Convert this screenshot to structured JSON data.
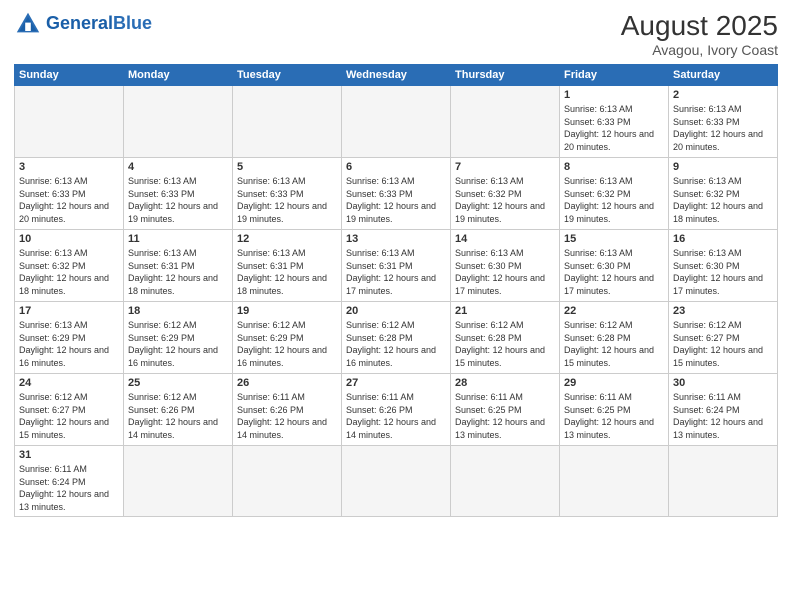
{
  "header": {
    "logo_general": "General",
    "logo_blue": "Blue",
    "month_year": "August 2025",
    "location": "Avagou, Ivory Coast"
  },
  "weekdays": [
    "Sunday",
    "Monday",
    "Tuesday",
    "Wednesday",
    "Thursday",
    "Friday",
    "Saturday"
  ],
  "weeks": [
    [
      {
        "day": "",
        "info": ""
      },
      {
        "day": "",
        "info": ""
      },
      {
        "day": "",
        "info": ""
      },
      {
        "day": "",
        "info": ""
      },
      {
        "day": "",
        "info": ""
      },
      {
        "day": "1",
        "info": "Sunrise: 6:13 AM\nSunset: 6:33 PM\nDaylight: 12 hours and 20 minutes."
      },
      {
        "day": "2",
        "info": "Sunrise: 6:13 AM\nSunset: 6:33 PM\nDaylight: 12 hours and 20 minutes."
      }
    ],
    [
      {
        "day": "3",
        "info": "Sunrise: 6:13 AM\nSunset: 6:33 PM\nDaylight: 12 hours and 20 minutes."
      },
      {
        "day": "4",
        "info": "Sunrise: 6:13 AM\nSunset: 6:33 PM\nDaylight: 12 hours and 19 minutes."
      },
      {
        "day": "5",
        "info": "Sunrise: 6:13 AM\nSunset: 6:33 PM\nDaylight: 12 hours and 19 minutes."
      },
      {
        "day": "6",
        "info": "Sunrise: 6:13 AM\nSunset: 6:33 PM\nDaylight: 12 hours and 19 minutes."
      },
      {
        "day": "7",
        "info": "Sunrise: 6:13 AM\nSunset: 6:32 PM\nDaylight: 12 hours and 19 minutes."
      },
      {
        "day": "8",
        "info": "Sunrise: 6:13 AM\nSunset: 6:32 PM\nDaylight: 12 hours and 19 minutes."
      },
      {
        "day": "9",
        "info": "Sunrise: 6:13 AM\nSunset: 6:32 PM\nDaylight: 12 hours and 18 minutes."
      }
    ],
    [
      {
        "day": "10",
        "info": "Sunrise: 6:13 AM\nSunset: 6:32 PM\nDaylight: 12 hours and 18 minutes."
      },
      {
        "day": "11",
        "info": "Sunrise: 6:13 AM\nSunset: 6:31 PM\nDaylight: 12 hours and 18 minutes."
      },
      {
        "day": "12",
        "info": "Sunrise: 6:13 AM\nSunset: 6:31 PM\nDaylight: 12 hours and 18 minutes."
      },
      {
        "day": "13",
        "info": "Sunrise: 6:13 AM\nSunset: 6:31 PM\nDaylight: 12 hours and 17 minutes."
      },
      {
        "day": "14",
        "info": "Sunrise: 6:13 AM\nSunset: 6:30 PM\nDaylight: 12 hours and 17 minutes."
      },
      {
        "day": "15",
        "info": "Sunrise: 6:13 AM\nSunset: 6:30 PM\nDaylight: 12 hours and 17 minutes."
      },
      {
        "day": "16",
        "info": "Sunrise: 6:13 AM\nSunset: 6:30 PM\nDaylight: 12 hours and 17 minutes."
      }
    ],
    [
      {
        "day": "17",
        "info": "Sunrise: 6:13 AM\nSunset: 6:29 PM\nDaylight: 12 hours and 16 minutes."
      },
      {
        "day": "18",
        "info": "Sunrise: 6:12 AM\nSunset: 6:29 PM\nDaylight: 12 hours and 16 minutes."
      },
      {
        "day": "19",
        "info": "Sunrise: 6:12 AM\nSunset: 6:29 PM\nDaylight: 12 hours and 16 minutes."
      },
      {
        "day": "20",
        "info": "Sunrise: 6:12 AM\nSunset: 6:28 PM\nDaylight: 12 hours and 16 minutes."
      },
      {
        "day": "21",
        "info": "Sunrise: 6:12 AM\nSunset: 6:28 PM\nDaylight: 12 hours and 15 minutes."
      },
      {
        "day": "22",
        "info": "Sunrise: 6:12 AM\nSunset: 6:28 PM\nDaylight: 12 hours and 15 minutes."
      },
      {
        "day": "23",
        "info": "Sunrise: 6:12 AM\nSunset: 6:27 PM\nDaylight: 12 hours and 15 minutes."
      }
    ],
    [
      {
        "day": "24",
        "info": "Sunrise: 6:12 AM\nSunset: 6:27 PM\nDaylight: 12 hours and 15 minutes."
      },
      {
        "day": "25",
        "info": "Sunrise: 6:12 AM\nSunset: 6:26 PM\nDaylight: 12 hours and 14 minutes."
      },
      {
        "day": "26",
        "info": "Sunrise: 6:11 AM\nSunset: 6:26 PM\nDaylight: 12 hours and 14 minutes."
      },
      {
        "day": "27",
        "info": "Sunrise: 6:11 AM\nSunset: 6:26 PM\nDaylight: 12 hours and 14 minutes."
      },
      {
        "day": "28",
        "info": "Sunrise: 6:11 AM\nSunset: 6:25 PM\nDaylight: 12 hours and 13 minutes."
      },
      {
        "day": "29",
        "info": "Sunrise: 6:11 AM\nSunset: 6:25 PM\nDaylight: 12 hours and 13 minutes."
      },
      {
        "day": "30",
        "info": "Sunrise: 6:11 AM\nSunset: 6:24 PM\nDaylight: 12 hours and 13 minutes."
      }
    ],
    [
      {
        "day": "31",
        "info": "Sunrise: 6:11 AM\nSunset: 6:24 PM\nDaylight: 12 hours and 13 minutes."
      },
      {
        "day": "",
        "info": ""
      },
      {
        "day": "",
        "info": ""
      },
      {
        "day": "",
        "info": ""
      },
      {
        "day": "",
        "info": ""
      },
      {
        "day": "",
        "info": ""
      },
      {
        "day": "",
        "info": ""
      }
    ]
  ]
}
